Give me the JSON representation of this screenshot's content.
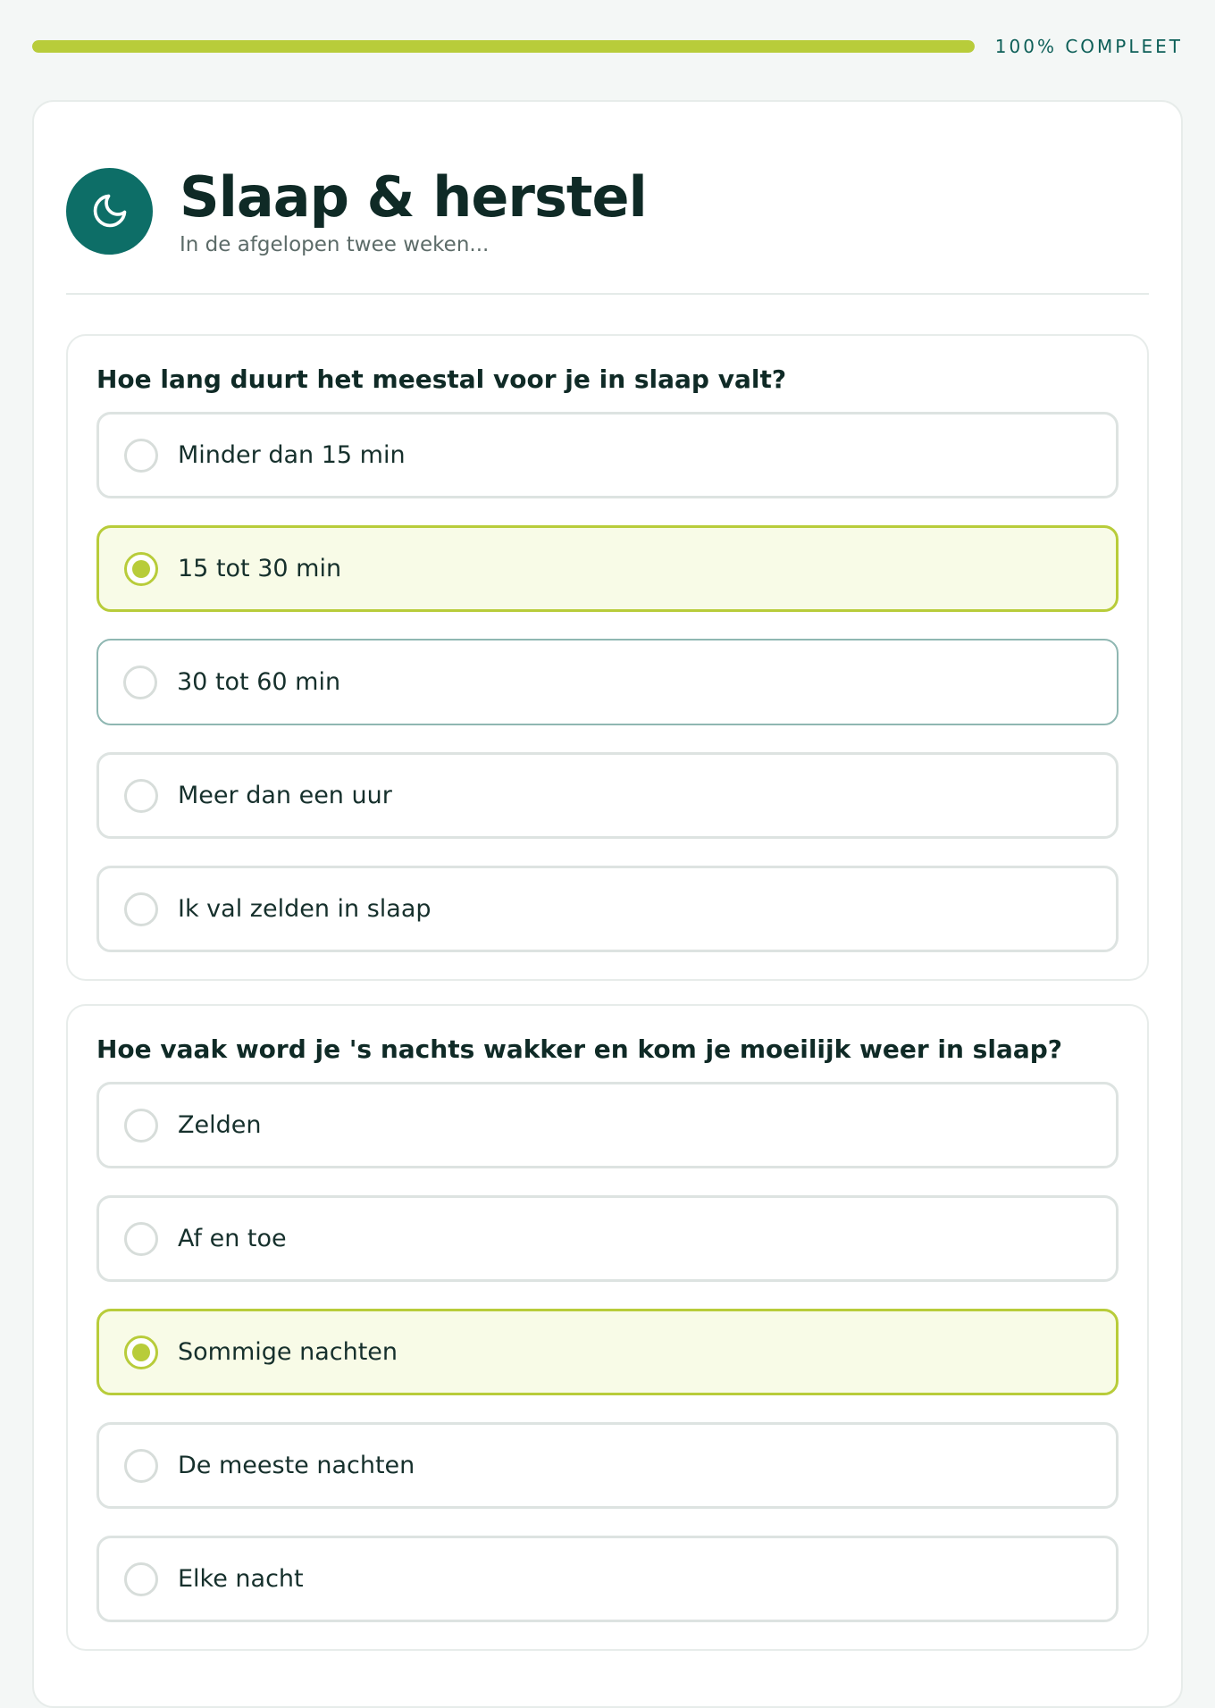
{
  "progress": {
    "percent": 100,
    "label": "100% COMPLEET",
    "fill_color": "#b8cc3a"
  },
  "section": {
    "icon": "moon-icon",
    "title": "Slaap & herstel",
    "subtitle": "In de afgelopen twee weken..."
  },
  "questions": [
    {
      "text": "Hoe lang duurt het meestal voor je in slaap valt?",
      "options": [
        {
          "label": "Minder dan 15 min",
          "selected": false
        },
        {
          "label": "15 tot 30 min",
          "selected": true
        },
        {
          "label": "30 tot 60 min",
          "selected": false,
          "hovered": true
        },
        {
          "label": "Meer dan een uur",
          "selected": false
        },
        {
          "label": "Ik val zelden in slaap",
          "selected": false
        }
      ]
    },
    {
      "text": "Hoe vaak word je 's nachts wakker en kom je moeilijk weer in slaap?",
      "options": [
        {
          "label": "Zelden",
          "selected": false
        },
        {
          "label": "Af en toe",
          "selected": false
        },
        {
          "label": "Sommige nachten",
          "selected": true
        },
        {
          "label": "De meeste nachten",
          "selected": false
        },
        {
          "label": "Elke nacht",
          "selected": false
        }
      ]
    }
  ],
  "colors": {
    "accent": "#b8cc3a",
    "brand": "#0d6e67",
    "selected_bg": "#f8fbe7"
  }
}
